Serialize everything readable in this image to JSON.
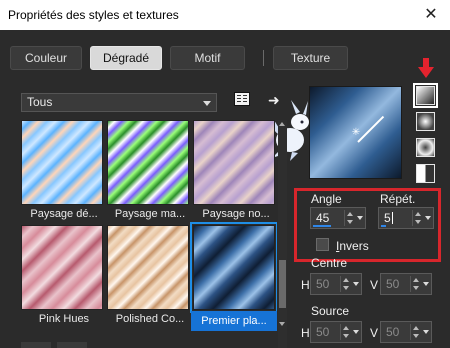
{
  "window": {
    "title": "Propriétés des styles et textures",
    "close_glyph": "✕"
  },
  "tabs": [
    {
      "label": "Couleur",
      "active": false
    },
    {
      "label": "Dégradé",
      "active": true
    },
    {
      "label": "Motif",
      "active": false
    },
    {
      "label": "Texture",
      "active": false
    }
  ],
  "category": {
    "selected": "Tous"
  },
  "gradients": [
    {
      "caption": "Paysage dé...",
      "selected": false
    },
    {
      "caption": "Paysage ma...",
      "selected": false
    },
    {
      "caption": "Paysage no...",
      "selected": false
    },
    {
      "caption": "Pink Hues",
      "selected": false
    },
    {
      "caption": "Polished Co...",
      "selected": false
    },
    {
      "caption": "Premier pla...",
      "selected": true
    }
  ],
  "settings": {
    "angle_label": "Angle",
    "angle_value": "45",
    "repeat_label": "Répét.",
    "repeat_value": "5",
    "invert_label": "Invers",
    "invert_checked": false,
    "center_label": "Centre",
    "center_h_label": "H",
    "center_h_value": "50",
    "center_v_label": "V",
    "center_v_value": "50",
    "source_label": "Source",
    "source_h_label": "H",
    "source_h_value": "50",
    "source_v_label": "V",
    "source_v_value": "50"
  },
  "style_buttons": [
    "linear-gradient-icon",
    "rectangular-gradient-icon",
    "radial-gradient-icon",
    "sunburst-gradient-icon"
  ],
  "colors": {
    "accent": "#1673d6",
    "highlight": "#d7262c",
    "panel_bg": "#2b2b2b"
  }
}
